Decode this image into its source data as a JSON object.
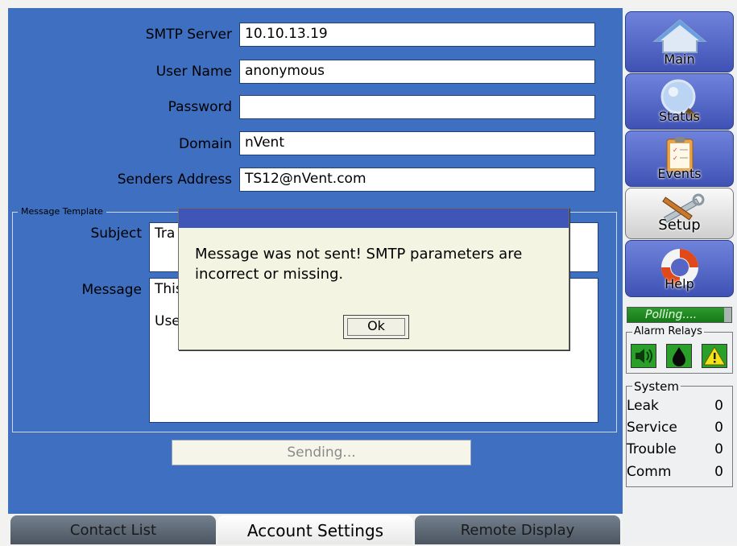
{
  "smtp_form": {
    "smtp_server_label": "SMTP Server",
    "smtp_server_value": "10.10.13.19",
    "user_name_label": "User Name",
    "user_name_value": "anonymous",
    "password_label": "Password",
    "password_value": "",
    "domain_label": "Domain",
    "domain_value": "nVent",
    "senders_address_label": "Senders Address",
    "senders_address_value": "TS12@nVent.com"
  },
  "message_template": {
    "legend": "Message Template",
    "subject_label": "Subject",
    "subject_value": "Tra",
    "message_label": "Message",
    "message_line1": "This",
    "message_line2": "Use"
  },
  "sending_status": "Sending...",
  "dialog": {
    "message": "Message was not sent! SMTP parameters are incorrect or missing.",
    "ok_label": "Ok"
  },
  "tabs": [
    {
      "label": "Contact List",
      "active": false
    },
    {
      "label": "Account Settings",
      "active": true
    },
    {
      "label": "Remote Display",
      "active": false
    }
  ],
  "nav": [
    {
      "label": "Main",
      "icon": "house-icon"
    },
    {
      "label": "Status",
      "icon": "magnifier-icon"
    },
    {
      "label": "Events",
      "icon": "clipboard-icon"
    },
    {
      "label": "Setup",
      "icon": "tools-icon"
    },
    {
      "label": "Help",
      "icon": "lifebuoy-icon"
    }
  ],
  "polling_status": "Polling....",
  "alarm_relays": {
    "legend": "Alarm Relays",
    "icons": [
      "speaker-icon",
      "water-drop-icon",
      "warning-icon"
    ]
  },
  "system": {
    "legend": "System",
    "rows": [
      {
        "label": "Leak",
        "value": "0"
      },
      {
        "label": "Service",
        "value": "0"
      },
      {
        "label": "Trouble",
        "value": "0"
      },
      {
        "label": "Comm",
        "value": "0"
      }
    ]
  },
  "colors": {
    "panel_blue": "#3e6fc0",
    "nav_blue": "#3f52b4",
    "polling_green": "#1f8a1f",
    "dialog_bg": "#f4f4e2"
  }
}
